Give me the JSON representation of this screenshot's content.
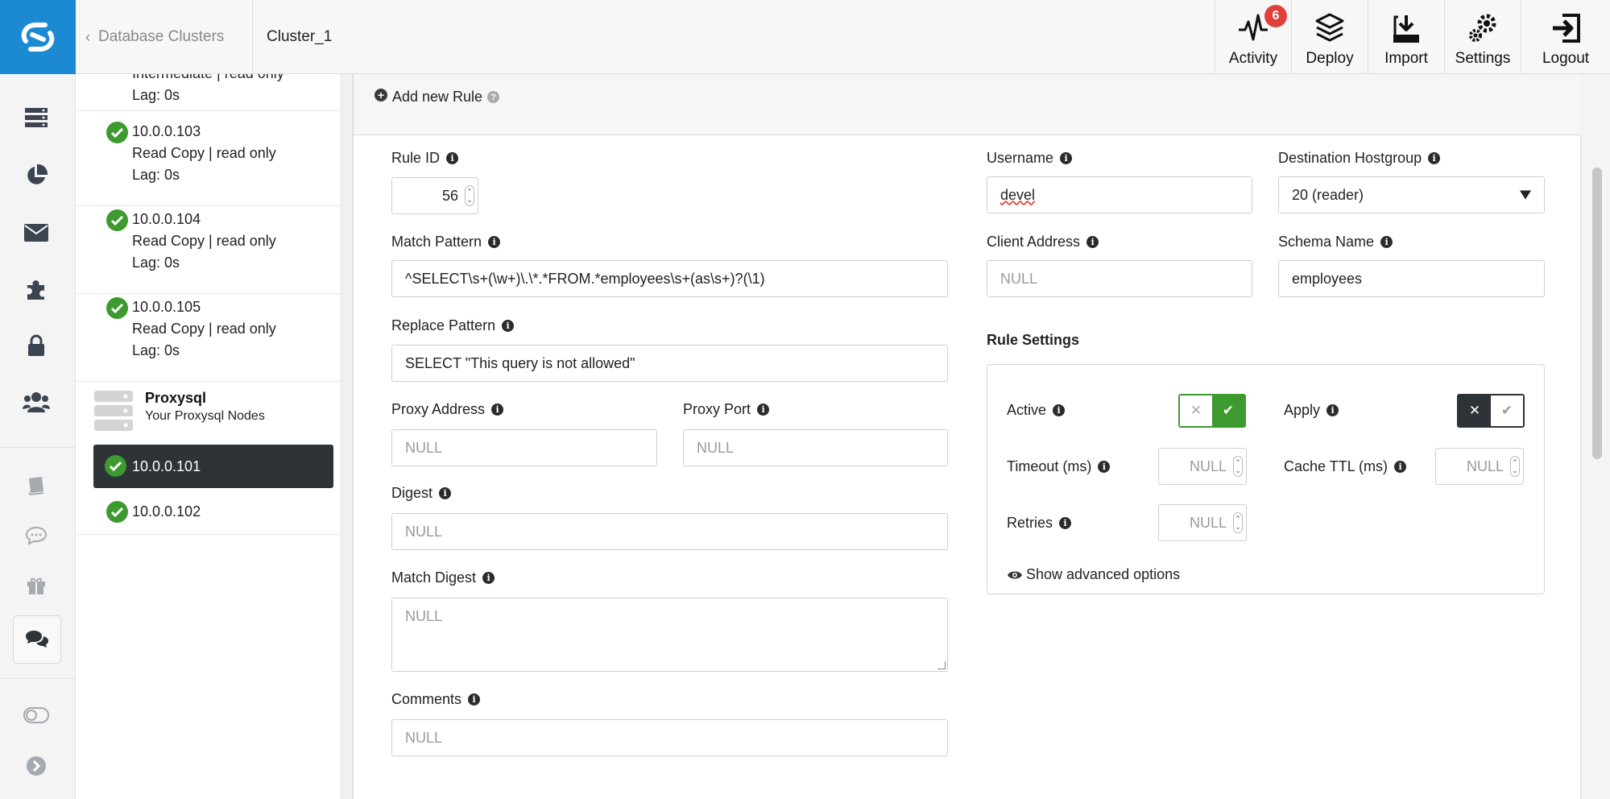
{
  "topbar": {
    "back_label": "Database Clusters",
    "cluster_name": "Cluster_1",
    "buttons": [
      {
        "label": "Activity",
        "icon": "activity-pulse-icon",
        "badge": "6"
      },
      {
        "label": "Deploy",
        "icon": "layers-icon"
      },
      {
        "label": "Import",
        "icon": "import-icon"
      },
      {
        "label": "Settings",
        "icon": "gears-icon"
      },
      {
        "label": "Logout",
        "icon": "logout-icon"
      }
    ]
  },
  "rail": {
    "icons": [
      "logo-icon",
      "servers-icon",
      "pie-chart-icon",
      "mail-icon",
      "puzzle-icon",
      "lock-icon",
      "users-icon",
      "book-icon",
      "chat-bubble-icon",
      "gift-icon",
      "comments-icon",
      "toggle-icon",
      "arrow-right-circle-icon"
    ]
  },
  "nodes": {
    "partial": {
      "line1": "Intermediate | read only",
      "lag": "Lag: 0s"
    },
    "items": [
      {
        "ip": "10.0.0.103",
        "role": "Read Copy | read only",
        "lag": "Lag: 0s"
      },
      {
        "ip": "10.0.0.104",
        "role": "Read Copy | read only",
        "lag": "Lag: 0s"
      },
      {
        "ip": "10.0.0.105",
        "role": "Read Copy | read only",
        "lag": "Lag: 0s"
      }
    ],
    "proxy_group": {
      "title": "Proxysql",
      "subtitle": "Your Proxysql Nodes"
    },
    "proxy_nodes": [
      {
        "ip": "10.0.0.101",
        "selected": true
      },
      {
        "ip": "10.0.0.102",
        "selected": false
      }
    ]
  },
  "form": {
    "add_rule_label": "Add new Rule",
    "rule_id": {
      "label": "Rule ID",
      "value": "56"
    },
    "match_pattern": {
      "label": "Match Pattern",
      "value": "^SELECT\\s+(\\w+)\\.\\*.*FROM.*employees\\s+(as\\s+)?(\\1)"
    },
    "replace_pattern": {
      "label": "Replace Pattern",
      "value": "SELECT \"This query is not allowed\""
    },
    "proxy_address": {
      "label": "Proxy Address",
      "placeholder": "NULL"
    },
    "proxy_port": {
      "label": "Proxy Port",
      "placeholder": "NULL"
    },
    "digest": {
      "label": "Digest",
      "placeholder": "NULL"
    },
    "match_digest": {
      "label": "Match Digest",
      "placeholder": "NULL"
    },
    "comments": {
      "label": "Comments",
      "placeholder": "NULL"
    },
    "username": {
      "label": "Username",
      "value": "devel"
    },
    "destination_hostgroup": {
      "label": "Destination Hostgroup",
      "value": "20 (reader)"
    },
    "client_address": {
      "label": "Client Address",
      "placeholder": "NULL"
    },
    "schema_name": {
      "label": "Schema Name",
      "value": "employees"
    },
    "rule_settings": {
      "title": "Rule Settings",
      "active": {
        "label": "Active",
        "on": true
      },
      "apply": {
        "label": "Apply",
        "on": false
      },
      "timeout": {
        "label": "Timeout (ms)",
        "placeholder": "NULL"
      },
      "cache_ttl": {
        "label": "Cache TTL (ms)",
        "placeholder": "NULL"
      },
      "retries": {
        "label": "Retries",
        "placeholder": "NULL"
      },
      "show_advanced": "Show advanced options"
    }
  },
  "colors": {
    "brand": "#1b8ad3",
    "success": "#3c9a2e",
    "dark": "#2e3338",
    "badge": "#e0403a"
  }
}
